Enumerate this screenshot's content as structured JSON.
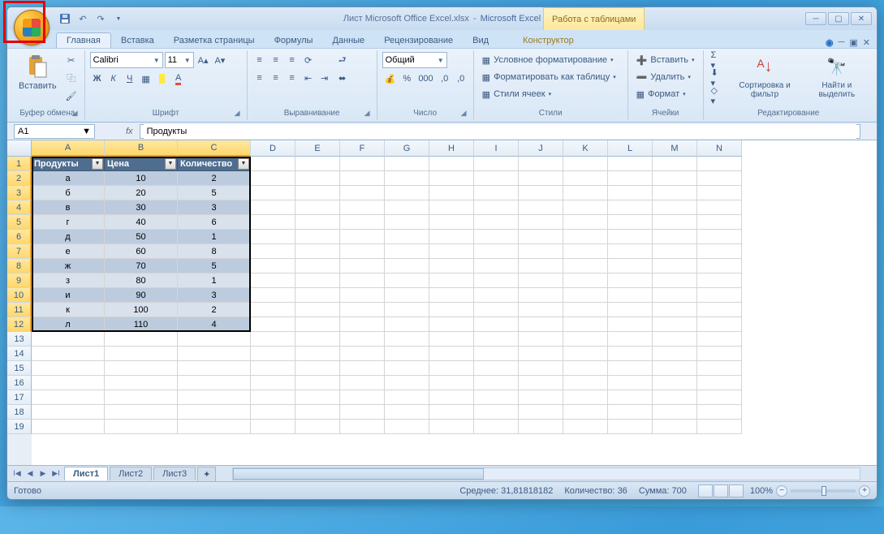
{
  "title": {
    "doc": "Лист Microsoft Office Excel.xlsx",
    "app": "Microsoft Excel"
  },
  "contextual_tab_header": "Работа с таблицами",
  "tabs": [
    "Главная",
    "Вставка",
    "Разметка страницы",
    "Формулы",
    "Данные",
    "Рецензирование",
    "Вид",
    "Конструктор"
  ],
  "ribbon": {
    "clipboard": {
      "label": "Буфер обмена",
      "paste": "Вставить"
    },
    "font": {
      "label": "Шрифт",
      "name": "Calibri",
      "size": "11"
    },
    "alignment": {
      "label": "Выравнивание"
    },
    "number": {
      "label": "Число",
      "format": "Общий"
    },
    "styles": {
      "label": "Стили",
      "cond": "Условное форматирование",
      "astable": "Форматировать как таблицу",
      "cellstyles": "Стили ячеек"
    },
    "cells": {
      "label": "Ячейки",
      "insert": "Вставить",
      "delete": "Удалить",
      "format": "Формат"
    },
    "editing": {
      "label": "Редактирование",
      "sort": "Сортировка и фильтр",
      "find": "Найти и выделить"
    }
  },
  "namebox": "A1",
  "formula": "Продукты",
  "columns": [
    "A",
    "B",
    "C",
    "D",
    "E",
    "F",
    "G",
    "H",
    "I",
    "J",
    "K",
    "L",
    "M",
    "N"
  ],
  "table": {
    "headers": [
      "Продукты",
      "Цена",
      "Количество"
    ],
    "rows": [
      [
        "а",
        "10",
        "2"
      ],
      [
        "б",
        "20",
        "5"
      ],
      [
        "в",
        "30",
        "3"
      ],
      [
        "г",
        "40",
        "6"
      ],
      [
        "д",
        "50",
        "1"
      ],
      [
        "е",
        "60",
        "8"
      ],
      [
        "ж",
        "70",
        "5"
      ],
      [
        "з",
        "80",
        "1"
      ],
      [
        "и",
        "90",
        "3"
      ],
      [
        "к",
        "100",
        "2"
      ],
      [
        "л",
        "110",
        "4"
      ]
    ]
  },
  "sheets": [
    "Лист1",
    "Лист2",
    "Лист3"
  ],
  "status": {
    "ready": "Готово",
    "avg_label": "Среднее:",
    "avg": "31,81818182",
    "count_label": "Количество:",
    "count": "36",
    "sum_label": "Сумма:",
    "sum": "700",
    "zoom": "100%"
  }
}
